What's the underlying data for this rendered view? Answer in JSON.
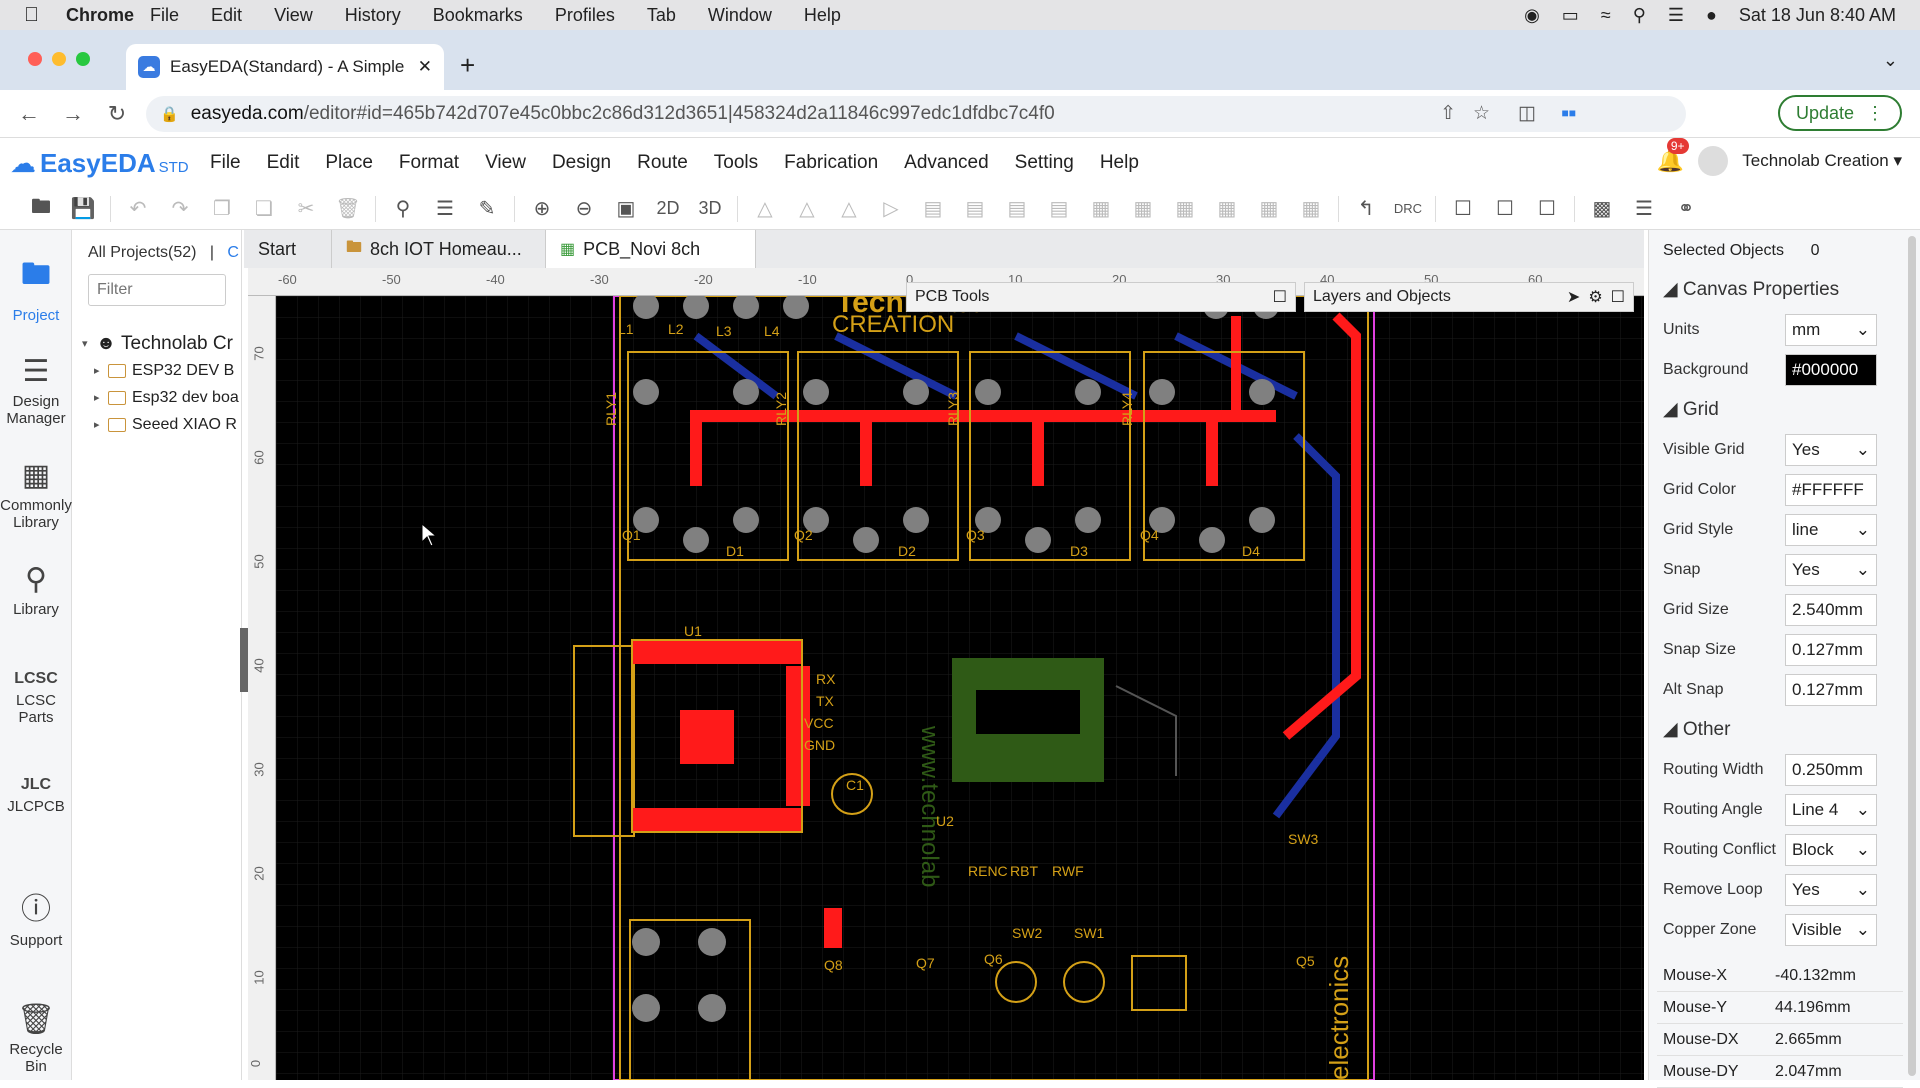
{
  "mac_menu": {
    "app": "Chrome",
    "items": [
      "File",
      "Edit",
      "View",
      "History",
      "Bookmarks",
      "Profiles",
      "Tab",
      "Window",
      "Help"
    ],
    "datetime": "Sat 18 Jun  8:40 AM"
  },
  "browser": {
    "tab_title": "EasyEDA(Standard) - A Simple",
    "url_domain": "easyeda.com",
    "url_path": "/editor#id=465b742d707e45c0bbc2c86d312d3651|458324d2a11846c997edc1dfdbc7c4f0",
    "update_label": "Update"
  },
  "app": {
    "logo": "EasyEDA",
    "edition": "STD",
    "menu": [
      "File",
      "Edit",
      "Place",
      "Format",
      "View",
      "Design",
      "Route",
      "Tools",
      "Fabrication",
      "Advanced",
      "Setting",
      "Help"
    ],
    "notifications": "9+",
    "user": "Technolab Creation"
  },
  "toolbar": {
    "view_2d": "2D",
    "view_3d": "3D",
    "drc": "DRC"
  },
  "leftnav": [
    {
      "label": "Project"
    },
    {
      "label": "Design Manager"
    },
    {
      "label": "Commonly Library"
    },
    {
      "label": "Library"
    },
    {
      "label": "LCSC Parts"
    },
    {
      "label": "JLCPCB"
    },
    {
      "label": "Support"
    },
    {
      "label": "Recycle Bin"
    }
  ],
  "project_panel": {
    "header": "All Projects(52)",
    "header_sep": "|",
    "header_cut": "C",
    "filter_placeholder": "Filter",
    "root": "Technolab Cr",
    "items": [
      "ESP32 DEV B",
      "Esp32 dev boa",
      "Seeed XIAO R"
    ]
  },
  "doc_tabs": [
    {
      "label": "Start"
    },
    {
      "label": "8ch IOT Homeau..."
    },
    {
      "label": "PCB_Novi 8ch"
    }
  ],
  "ruler_top": [
    "-60",
    "-50",
    "-40",
    "-30",
    "-20",
    "-10",
    "0",
    "10",
    "20",
    "30",
    "40",
    "50",
    "60"
  ],
  "ruler_left": [
    "70",
    "60",
    "50",
    "40",
    "30",
    "20",
    "10",
    "0"
  ],
  "floating_panels": {
    "pcb_tools": "PCB Tools",
    "layers": "Layers and Objects"
  },
  "pcb_labels": {
    "brand": "CREATION",
    "brand_top": "Technolab",
    "site": "www.technolab",
    "side": "electronics",
    "relays": [
      "RLY1",
      "RLY2",
      "RLY3",
      "RLY4"
    ],
    "diodes": [
      "D1",
      "D2",
      "D3",
      "D4"
    ],
    "transistors": [
      "Q1",
      "Q2",
      "Q3",
      "Q4"
    ],
    "leds": [
      "L1",
      "L2",
      "L3",
      "L4"
    ],
    "pins": [
      "RX",
      "TX",
      "VCC",
      "GND"
    ],
    "misc": [
      "U1",
      "U2",
      "C1",
      "SW3",
      "SW2",
      "SW1",
      "Q5",
      "Q6",
      "Q7",
      "Q8",
      "RENC",
      "RBT",
      "RWF"
    ]
  },
  "properties": {
    "selected_label": "Selected Objects",
    "selected_count": "0",
    "canvas_title": "Canvas Properties",
    "units": {
      "label": "Units",
      "value": "mm"
    },
    "background": {
      "label": "Background",
      "value": "#000000"
    },
    "grid_title": "Grid",
    "visible_grid": {
      "label": "Visible Grid",
      "value": "Yes"
    },
    "grid_color": {
      "label": "Grid Color",
      "value": "#FFFFFF"
    },
    "grid_style": {
      "label": "Grid Style",
      "value": "line"
    },
    "snap": {
      "label": "Snap",
      "value": "Yes"
    },
    "grid_size": {
      "label": "Grid Size",
      "value": "2.540mm"
    },
    "snap_size": {
      "label": "Snap Size",
      "value": "0.127mm"
    },
    "alt_snap": {
      "label": "Alt Snap",
      "value": "0.127mm"
    },
    "other_title": "Other",
    "routing_width": {
      "label": "Routing Width",
      "value": "0.250mm"
    },
    "routing_angle": {
      "label": "Routing Angle",
      "value": "Line 4"
    },
    "routing_conflict": {
      "label": "Routing Conflict",
      "value": "Block"
    },
    "remove_loop": {
      "label": "Remove Loop",
      "value": "Yes"
    },
    "copper_zone": {
      "label": "Copper Zone",
      "value": "Visible"
    },
    "mouse": [
      {
        "k": "Mouse-X",
        "v": "-40.132mm"
      },
      {
        "k": "Mouse-Y",
        "v": "44.196mm"
      },
      {
        "k": "Mouse-DX",
        "v": "2.665mm"
      },
      {
        "k": "Mouse-DY",
        "v": "2.047mm"
      }
    ]
  }
}
